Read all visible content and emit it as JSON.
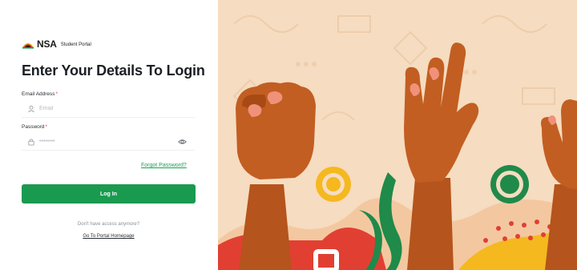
{
  "brand": {
    "name": "NSA",
    "subtitle": "Student Portal"
  },
  "login": {
    "title": "Enter Your Details To Login",
    "email": {
      "label": "Email Address",
      "required_mark": "*",
      "placeholder": "Email",
      "value": ""
    },
    "password": {
      "label": "Password",
      "required_mark": "*",
      "placeholder": "••••••••",
      "value": ""
    },
    "forgot_link": "Forgot Password?",
    "submit_label": "Log In",
    "no_access_text": "Don't have access anymore?",
    "portal_link": "Go To Portal Homepage"
  },
  "colors": {
    "accent_green": "#1a9a4f",
    "link_green": "#1e9e55",
    "required_red": "#e0443b",
    "illustration_bg": "#f6dcc0"
  },
  "icons": {
    "email_field": "user-icon",
    "password_field": "lock-icon",
    "password_toggle": "eye-icon"
  }
}
